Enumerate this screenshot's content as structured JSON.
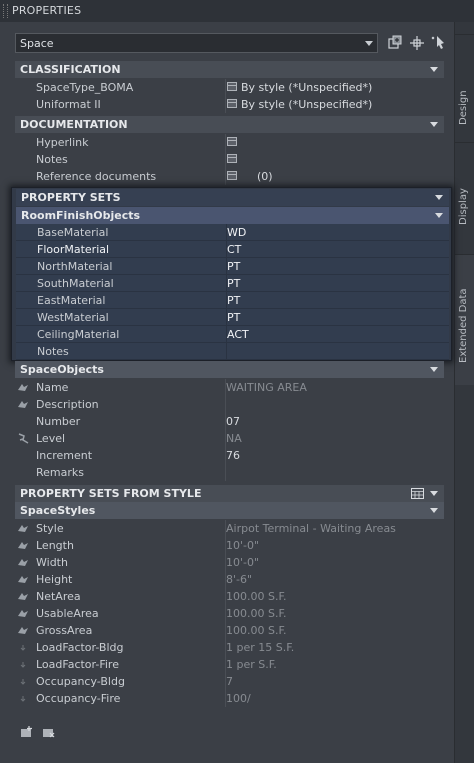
{
  "titlebar": {
    "title": "PROPERTIES"
  },
  "side_tabs": [
    "Design",
    "Display",
    "Extended Data"
  ],
  "selector": {
    "value": "Space"
  },
  "toolbar": {
    "icons": [
      "add-to-selection-icon",
      "pick-object-icon",
      "quick-select-icon"
    ]
  },
  "classification": {
    "title": "CLASSIFICATION",
    "rows": [
      {
        "name": "SpaceType_BOMA",
        "value": "By style (*Unspecified*)"
      },
      {
        "name": "Uniformat II",
        "value": "By style (*Unspecified*)"
      }
    ]
  },
  "documentation": {
    "title": "DOCUMENTATION",
    "rows": [
      {
        "name": "Hyperlink",
        "value": ""
      },
      {
        "name": "Notes",
        "value": ""
      },
      {
        "name": "Reference documents",
        "value": "(0)"
      }
    ]
  },
  "property_sets": {
    "title": "PROPERTY SETS",
    "room_finish": {
      "title": "RoomFinishObjects",
      "rows": [
        {
          "name": "BaseMaterial",
          "value": "WD"
        },
        {
          "name": "FloorMaterial",
          "value": "CT"
        },
        {
          "name": "NorthMaterial",
          "value": "PT"
        },
        {
          "name": "SouthMaterial",
          "value": "PT"
        },
        {
          "name": "EastMaterial",
          "value": "PT"
        },
        {
          "name": "WestMaterial",
          "value": "PT"
        },
        {
          "name": "CeilingMaterial",
          "value": "ACT"
        },
        {
          "name": "Notes",
          "value": ""
        }
      ]
    },
    "space_objects": {
      "title": "SpaceObjects",
      "rows": [
        {
          "name": "Name",
          "value": "WAITING AREA",
          "dim": true
        },
        {
          "name": "Description",
          "value": ""
        },
        {
          "name": "Number",
          "value": "07"
        },
        {
          "name": "Level",
          "value": "NA",
          "dim": true
        },
        {
          "name": "Increment",
          "value": "76"
        },
        {
          "name": "Remarks",
          "value": ""
        }
      ]
    }
  },
  "from_style": {
    "title": "PROPERTY SETS FROM STYLE",
    "space_styles": {
      "title": "SpaceStyles",
      "rows": [
        {
          "name": "Style",
          "value": "Airpot Terminal - Waiting Areas"
        },
        {
          "name": "Length",
          "value": "10'-0\""
        },
        {
          "name": "Width",
          "value": "10'-0\""
        },
        {
          "name": "Height",
          "value": "8'-6\""
        },
        {
          "name": "NetArea",
          "value": "100.00 S.F."
        },
        {
          "name": "UsableArea",
          "value": "100.00 S.F."
        },
        {
          "name": "GrossArea",
          "value": "100.00 S.F."
        },
        {
          "name": "LoadFactor-Bldg",
          "value": "1 per 15 S.F."
        },
        {
          "name": "LoadFactor-Fire",
          "value": "1 per  S.F."
        },
        {
          "name": "Occupancy-Bldg",
          "value": "7"
        },
        {
          "name": "Occupancy-Fire",
          "value": "100/"
        }
      ]
    }
  }
}
